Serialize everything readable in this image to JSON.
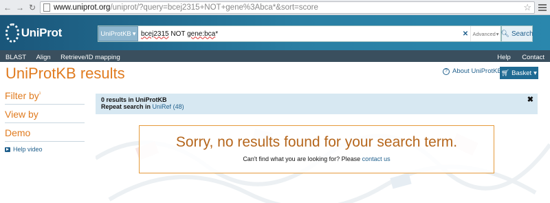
{
  "browser": {
    "url_host": "www.uniprot.org",
    "url_path": "/uniprot/?query=bcej2315+NOT+gene%3Abca*&sort=score"
  },
  "header": {
    "logo_text": "UniProt",
    "db_select": "UniProtKB",
    "query_prefix": "bcej2315",
    "query_mid": " NOT ",
    "query_gene": "gene:bca",
    "query_suffix": "*",
    "advanced_label": "Advanced",
    "search_label": "Search"
  },
  "nav": {
    "left": [
      "BLAST",
      "Align",
      "Retrieve/ID mapping"
    ],
    "right": [
      "Help",
      "Contact"
    ]
  },
  "page": {
    "title": "UniProtKB results",
    "about_label": "About UniProtKB",
    "basket_label": "Basket"
  },
  "sidebar": {
    "filter_by": "Filter by",
    "filter_by_mark": "¹",
    "view_by": "View by",
    "demo": "Demo",
    "help_video": "Help video"
  },
  "info": {
    "results_line": "0 results in UniProtKB",
    "repeat_prefix": "Repeat search in",
    "uniref_link": "UniRef",
    "uniref_count": "(48)"
  },
  "sorry": {
    "title": "Sorry, no results found for your search term.",
    "sub_prefix": "Can't find what you are looking for? Please",
    "contact_link": "contact us"
  },
  "colors": {
    "accent_orange": "#e07b1f",
    "link_blue": "#1f5f8c",
    "header_blue": "#2a7fa3",
    "navbar_dark": "#3a4f5e"
  }
}
